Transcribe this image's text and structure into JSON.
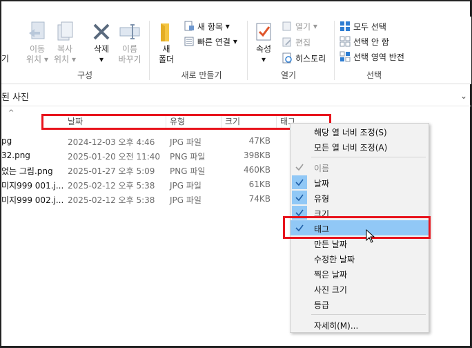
{
  "ribbon": {
    "groups": {
      "organize": "구성",
      "new": "새로 만들기",
      "open": "열기",
      "select": "선택"
    },
    "partial_left": "기",
    "move_to": [
      "이동",
      "위치"
    ],
    "copy_to": [
      "복사",
      "위치"
    ],
    "delete": "삭제",
    "rename": [
      "이름",
      "바꾸기"
    ],
    "new_folder": [
      "새",
      "폴더"
    ],
    "new_item": "새 항목",
    "easy_access": "빠른 연결",
    "properties": "속성",
    "open_btn": "열기",
    "edit": "편집",
    "history": "히스토리",
    "select_all": "모두 선택",
    "select_none": "선택 안 함",
    "invert_selection": "선택 영역 반전",
    "dropdown_arrow": "▾"
  },
  "address": {
    "path": "된 사진",
    "chevron": "⌄"
  },
  "columns": {
    "sort_caret": "^",
    "date": "날짜",
    "type": "유형",
    "size": "크기",
    "tag": "태그"
  },
  "files": [
    {
      "name": "pg",
      "date": "2024-12-03 오후 4:46",
      "type": "JPG 파일",
      "size": "47KB"
    },
    {
      "name": " 32.png",
      "date": "2025-01-20 오전 11:40",
      "type": "PNG 파일",
      "size": "398KB"
    },
    {
      "name": "었는 그림.png",
      "date": "2025-01-27 오후 5:09",
      "type": "PNG 파일",
      "size": "460KB"
    },
    {
      "name": "미지999 001.j...",
      "date": "2025-02-12 오후 5:38",
      "type": "JPG 파일",
      "size": "61KB"
    },
    {
      "name": "미지999 002.j...",
      "date": "2025-02-12 오후 5:38",
      "type": "JPG 파일",
      "size": "74KB"
    }
  ],
  "menu": {
    "size_column": "해당 열 너비 조정(S)",
    "size_all_columns": "모든 열 너비 조정(A)",
    "name": "이름",
    "date": "날짜",
    "type": "유형",
    "size": "크기",
    "tags": "태그",
    "date_created": "만든 날짜",
    "date_modified": "수정한 날짜",
    "date_taken": "찍은 날짜",
    "dimensions": "사진 크기",
    "rating": "등급",
    "more": "자세히(M)..."
  },
  "colors": {
    "highlight": "#91c8f6",
    "red_box": "#e8141d",
    "check": "#1f5fa8",
    "accent_blue": "#2d7dd2",
    "folder_yellow": "#f4c542"
  }
}
